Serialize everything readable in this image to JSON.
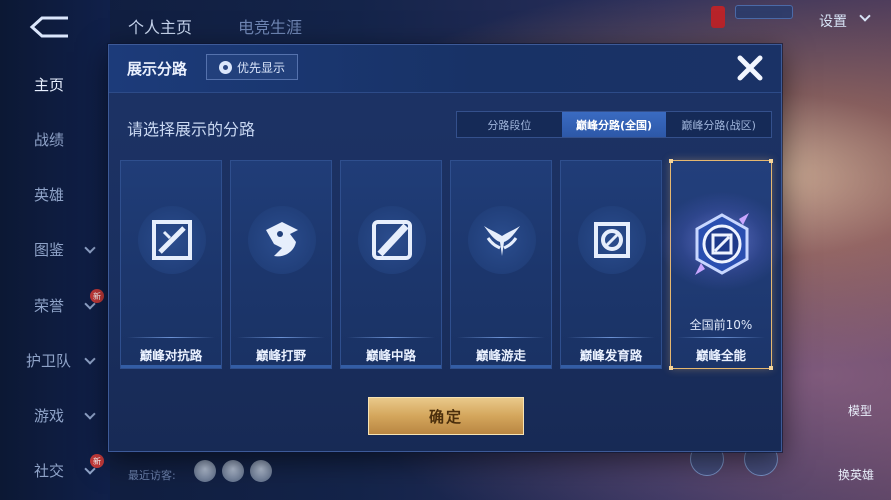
{
  "nav": {
    "items": [
      {
        "label": "主页",
        "active": true
      },
      {
        "label": "战绩"
      },
      {
        "label": "英雄"
      },
      {
        "label": "图鉴"
      },
      {
        "label": "荣誉"
      },
      {
        "label": "护卫队"
      },
      {
        "label": "游戏"
      },
      {
        "label": "社交"
      }
    ],
    "new_badge": "新"
  },
  "top_tabs": [
    "个人主页",
    "电竞生涯"
  ],
  "settings_label": "设置",
  "recent_visitors": "最近访客:",
  "side_buttons": {
    "model": "模型",
    "change_hero": "换英雄"
  },
  "modal": {
    "title": "展示分路",
    "priority_button": "优先显示",
    "section_title": "请选择展示的分路",
    "segments": [
      {
        "label": "分路段位"
      },
      {
        "label": "巅峰分路(全国)",
        "active": true
      },
      {
        "label": "巅峰分路(战区)"
      }
    ],
    "cards": [
      {
        "label": "巅峰对抗路",
        "icon": "crossed-swords-icon"
      },
      {
        "label": "巅峰打野",
        "icon": "dragon-icon"
      },
      {
        "label": "巅峰中路",
        "icon": "slash-icon"
      },
      {
        "label": "巅峰游走",
        "icon": "wings-icon"
      },
      {
        "label": "巅峰发育路",
        "icon": "crosshair-icon"
      },
      {
        "label": "巅峰全能",
        "icon": "allround-medal-icon",
        "selected": true,
        "rank": "全国前10%"
      }
    ],
    "confirm_label": "确定"
  },
  "colors": {
    "accent_blue": "#2d58a8",
    "gold": "#d4a65c",
    "selected_border": "#e5b770"
  }
}
